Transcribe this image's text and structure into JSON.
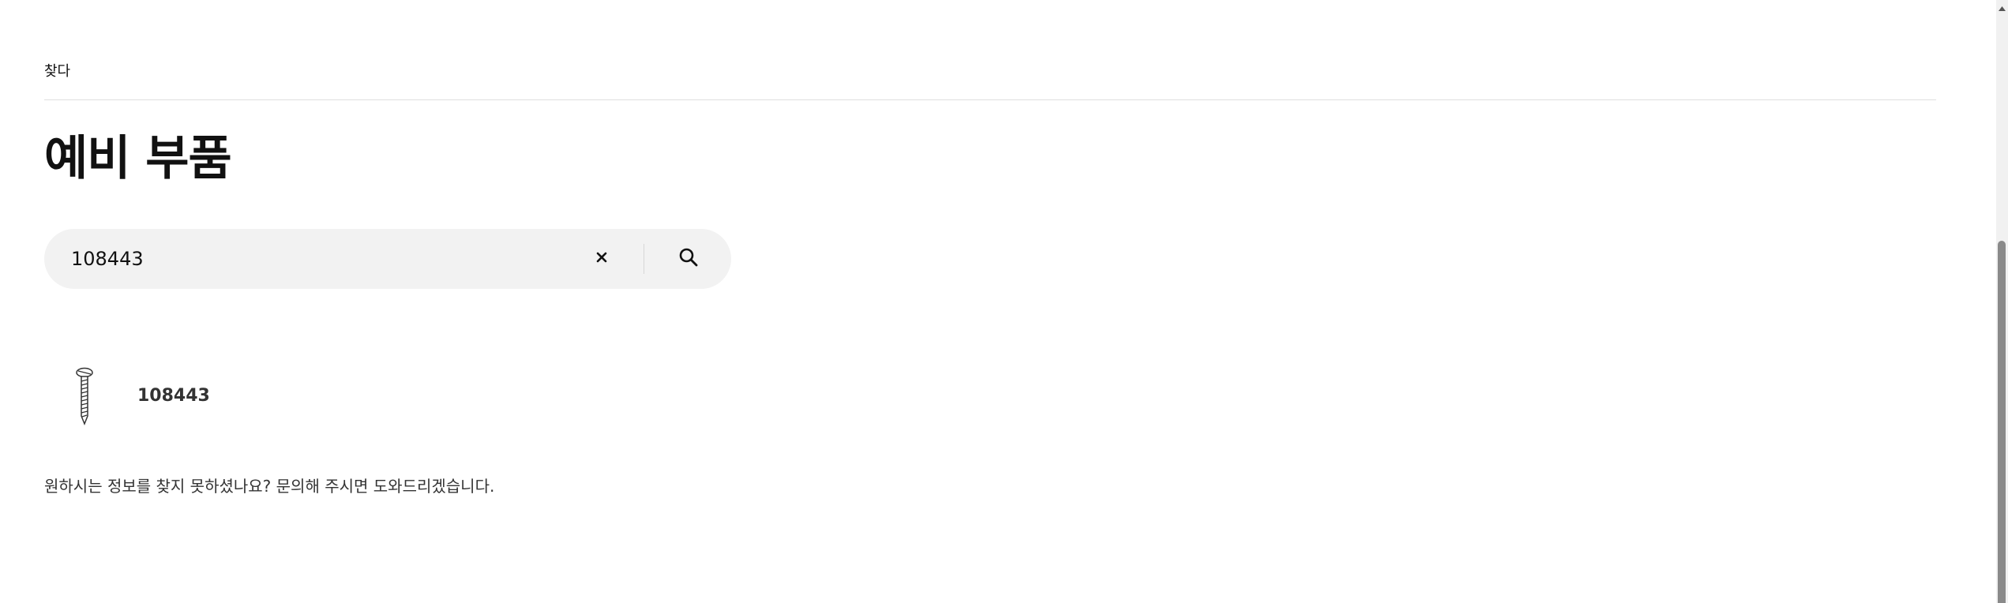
{
  "breadcrumb": {
    "label": "찾다"
  },
  "page": {
    "title": "예비 부품"
  },
  "search": {
    "value": "108443",
    "placeholder": "",
    "clear_icon": "close-icon",
    "search_icon": "search-icon"
  },
  "results": [
    {
      "label": "108443",
      "icon": "screw-icon"
    }
  ],
  "help": {
    "text_before": "원하시는 정보를 찾지 못하셨나요? ",
    "link_text": "문의해 주시면 도와드리겠습니다."
  },
  "colors": {
    "search_bg": "#f2f2f2",
    "text": "#111111",
    "divider": "#dfdfdf",
    "scroll_thumb": "#8a8a8a"
  }
}
